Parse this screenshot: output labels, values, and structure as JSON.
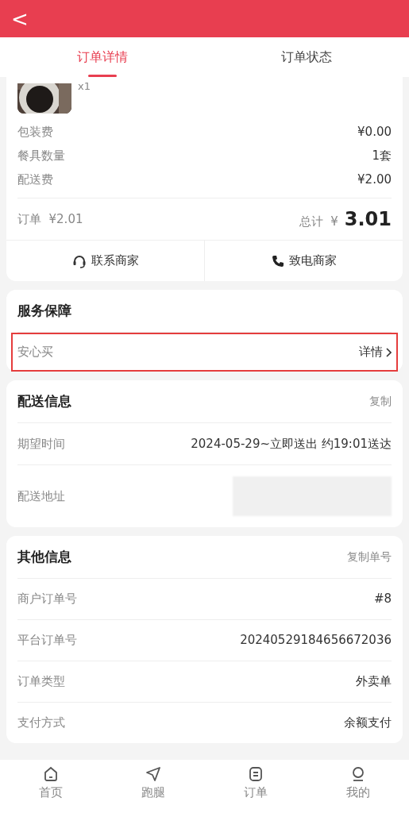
{
  "header": {
    "back": "<"
  },
  "tabs": [
    {
      "label": "订单详情",
      "selected": true
    },
    {
      "label": "订单状态",
      "selected": false
    }
  ],
  "product": {
    "quantity": "x1"
  },
  "fees": [
    {
      "label": "包装费",
      "value": "¥0.00"
    },
    {
      "label": "餐具数量",
      "value": "1套"
    },
    {
      "label": "配送费",
      "value": "¥2.00"
    }
  ],
  "summary": {
    "order_label": "订单",
    "order_amount": "¥2.01",
    "total_label": "总计",
    "currency": "¥",
    "total": "3.01"
  },
  "actions": [
    {
      "kind": "headset",
      "label": "联系商家"
    },
    {
      "kind": "phone",
      "label": "致电商家"
    }
  ],
  "service": {
    "title": "服务保障",
    "rows": [
      {
        "label": "安心买",
        "link": "详情",
        "highlighted": true
      }
    ]
  },
  "delivery": {
    "title": "配送信息",
    "action": "复制",
    "rows": [
      {
        "label": "期望时间",
        "value": "2024-05-29~立即送出 约19:01送达",
        "redacted": false
      },
      {
        "label": "配送地址",
        "redacted": true
      }
    ]
  },
  "other": {
    "title": "其他信息",
    "action": "复制单号",
    "rows": [
      {
        "label": "商户订单号",
        "value": "#8"
      },
      {
        "label": "平台订单号",
        "value": "20240529184656672036"
      },
      {
        "label": "订单类型",
        "value": "外卖单"
      },
      {
        "label": "支付方式",
        "value": "余额支付"
      }
    ]
  },
  "bottom_nav": [
    {
      "kind": "home",
      "label": "首页",
      "selected": false
    },
    {
      "kind": "send",
      "label": "跑腿",
      "selected": false
    },
    {
      "kind": "orders",
      "label": "订单",
      "selected": false
    },
    {
      "kind": "user",
      "label": "我的",
      "selected": false
    }
  ]
}
